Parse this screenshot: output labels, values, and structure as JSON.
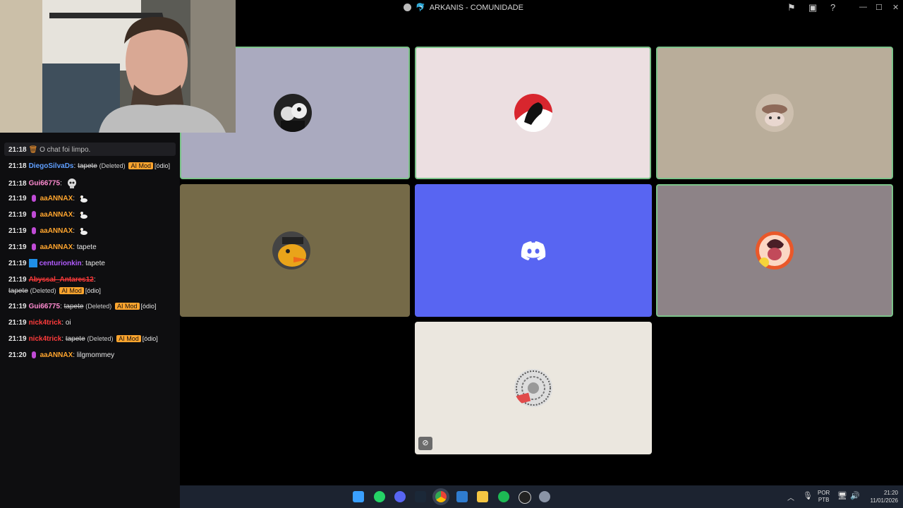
{
  "window": {
    "title": "ARKANIS - COMUNIDADE",
    "server_icon": "🐬"
  },
  "chat": {
    "lines": [
      {
        "time": "21:18",
        "system": "O chat foi limpo."
      },
      {
        "time": "21:18",
        "user": "DiegoSilvaDs",
        "text": "tapete",
        "deleted": "(Deleted)",
        "tag": "AI Mod",
        "reason": "[ódio]"
      },
      {
        "time": "21:18",
        "user": "Gui66775"
      },
      {
        "time": "21:19",
        "user": "aaANNAX"
      },
      {
        "time": "21:19",
        "user": "aaANNAX"
      },
      {
        "time": "21:19",
        "user": "aaANNAX"
      },
      {
        "time": "21:19",
        "user": "aaANNAX",
        "text": "tapete"
      },
      {
        "time": "21:19",
        "user": "centurionkin",
        "text": "tapete"
      },
      {
        "time": "21:19",
        "user": "Abyssal_Antares12",
        "text": "tapete",
        "deleted": "(Deleted)",
        "tag": "AI Mod",
        "reason": "[ódio]"
      },
      {
        "time": "21:19",
        "user": "Gui66775",
        "text": "tapete",
        "deleted": "(Deleted)",
        "tag": "AI Mod",
        "reason": "[ódio]"
      },
      {
        "time": "21:19",
        "user": "nick4trick",
        "text": "oi"
      },
      {
        "time": "21:19",
        "user": "nick4trick",
        "text": "tapete",
        "deleted": "(Deleted)",
        "tag": "AI Mod",
        "reason": "[ódio]"
      },
      {
        "time": "21:20",
        "user": "aaANNAX",
        "text": "lilgmommey"
      }
    ]
  },
  "tiles": {
    "colors": [
      "#aaaabf",
      "#ecdfe1",
      "#b9ad9a",
      "#756a48",
      "#5865f2",
      "#8d8387",
      "#ebe7df"
    ]
  },
  "tray": {
    "lang1": "POR",
    "lang2": "PTB",
    "time": "21:20",
    "date": "11/01/2026"
  }
}
